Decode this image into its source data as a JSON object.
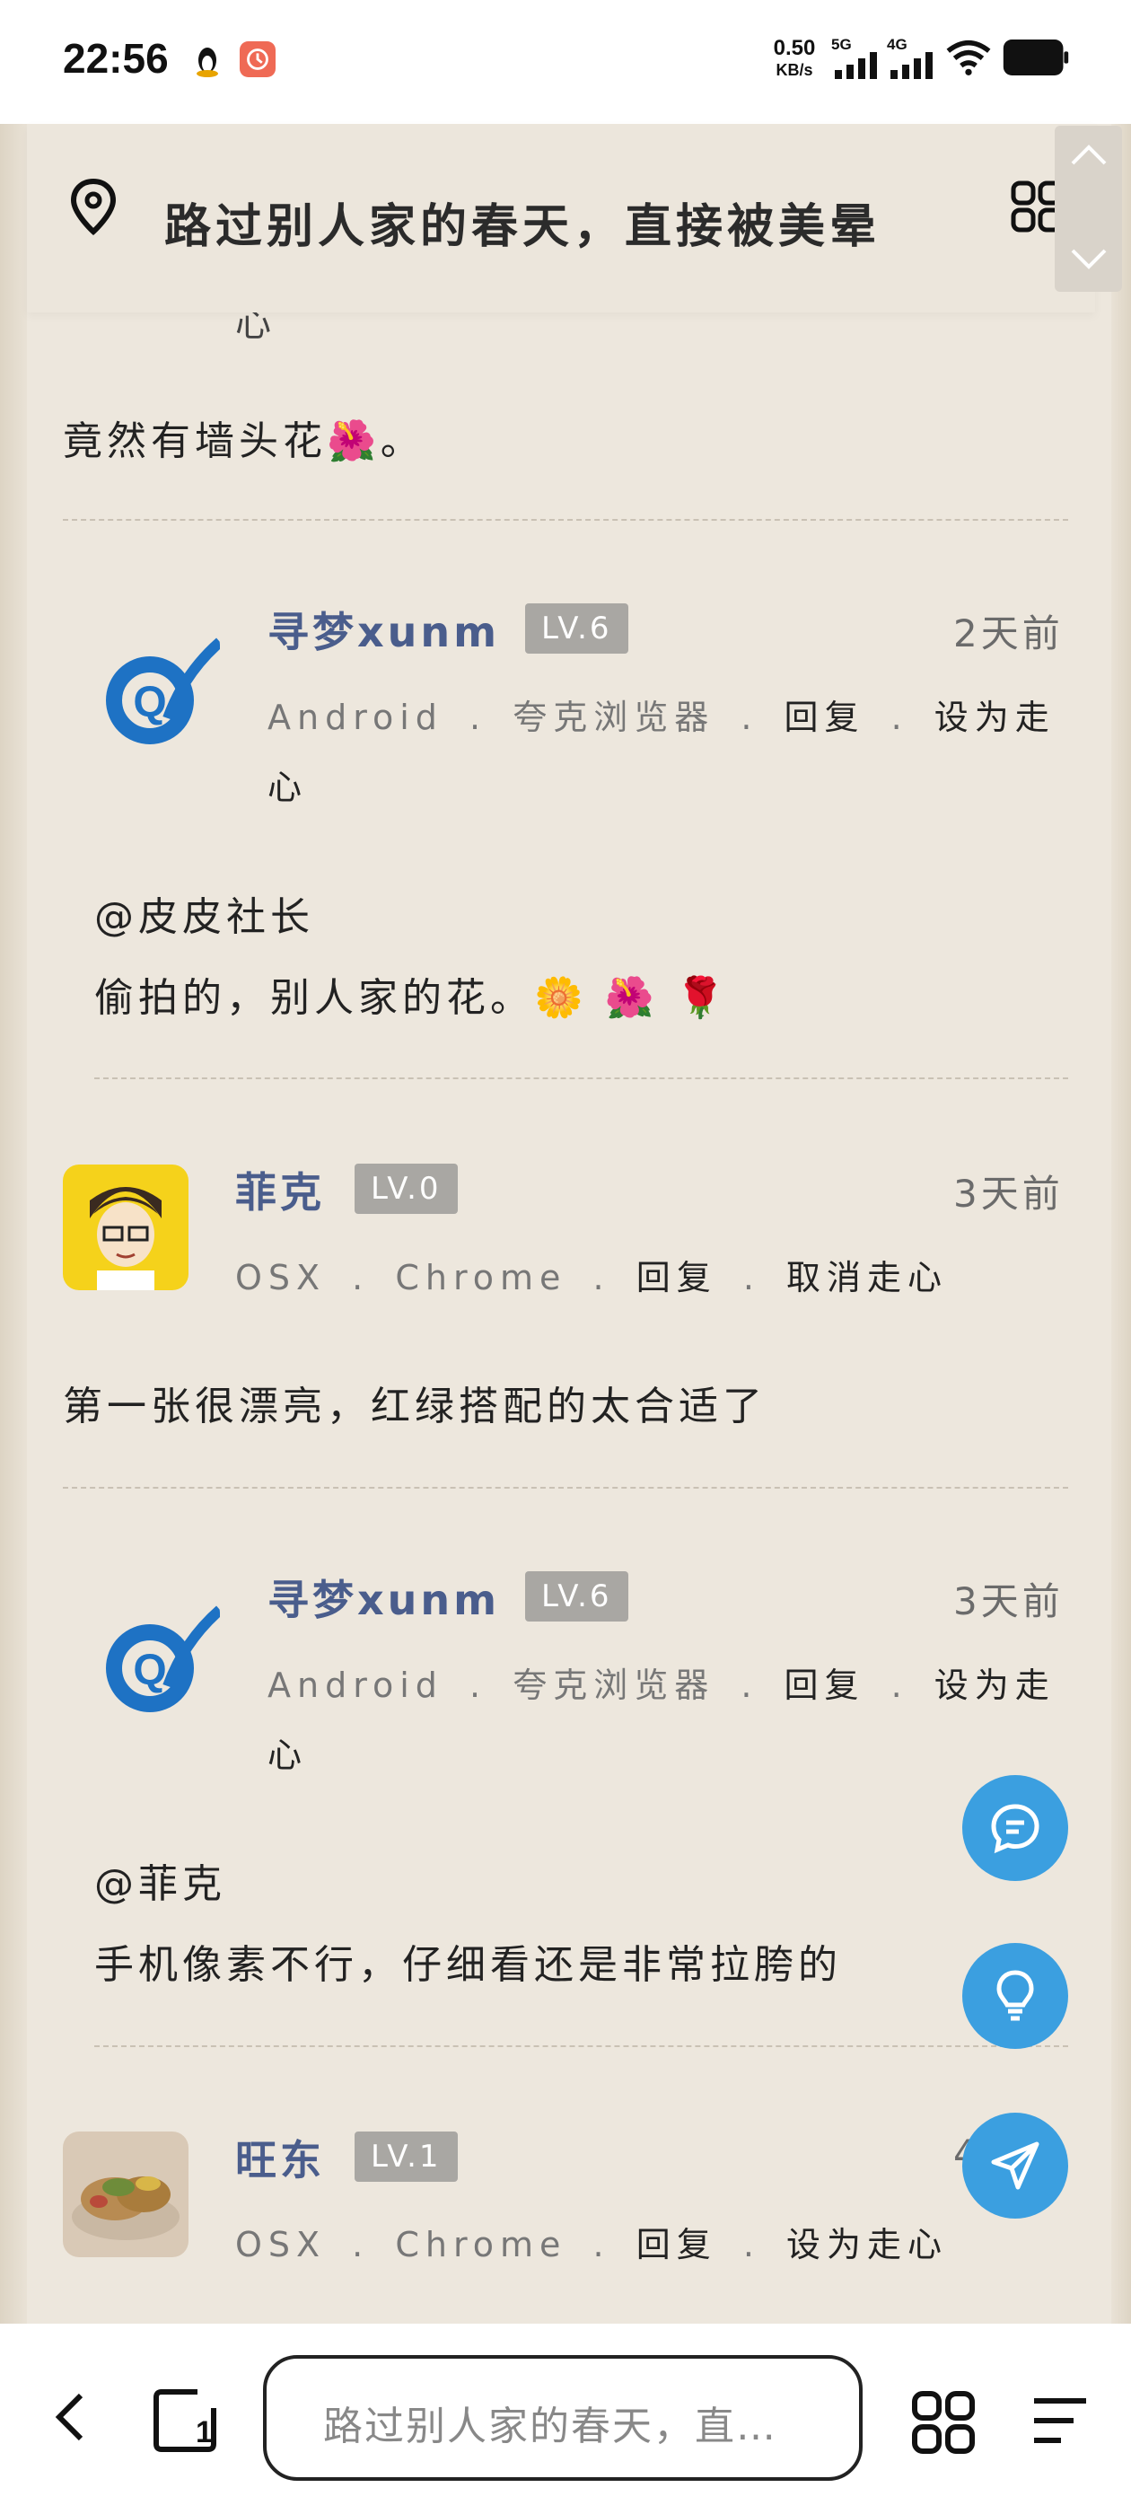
{
  "status_bar": {
    "time": "22:56",
    "net_speed_value": "0.50",
    "net_speed_unit": "KB/s",
    "sig1_label": "5G",
    "sig2_label": "4G"
  },
  "header": {
    "title": "路过别人家的春天，直接被美晕"
  },
  "cut_text": "心",
  "comments": [
    {
      "text": "竟然有墙头花🌺。"
    },
    {
      "user": "寻梦xunm",
      "level": "LV.6",
      "ago": "2天前",
      "meta": {
        "os": "Android",
        "browser": "夸克浏览器",
        "reply": "回复",
        "action": "设为走心"
      },
      "mention": "@皮皮社长",
      "text": "偷拍的，别人家的花。🌼 🌺 🌹"
    },
    {
      "user": "菲克",
      "level": "LV.0",
      "ago": "3天前",
      "meta": {
        "os": "OSX",
        "browser": "Chrome",
        "reply": "回复",
        "action": "取消走心"
      },
      "text": "第一张很漂亮，红绿搭配的太合适了"
    },
    {
      "user": "寻梦xunm",
      "level": "LV.6",
      "ago": "3天前",
      "meta": {
        "os": "Android",
        "browser": "夸克浏览器",
        "reply": "回复",
        "action": "设为走心"
      },
      "mention": "@菲克",
      "text": "手机像素不行，仔细看还是非常拉胯的"
    },
    {
      "user": "旺东",
      "level": "LV.1",
      "ago": "4",
      "meta": {
        "os": "OSX",
        "browser": "Chrome",
        "reply": "回复",
        "action": "设为走心"
      }
    }
  ],
  "meta_sep": ".",
  "bottom_bar": {
    "url_text": "路过别人家的春天，直…"
  },
  "colors": {
    "accent": "#3b9fe0",
    "username": "#4a5d8c",
    "level_badge": "#a9a7a3"
  }
}
